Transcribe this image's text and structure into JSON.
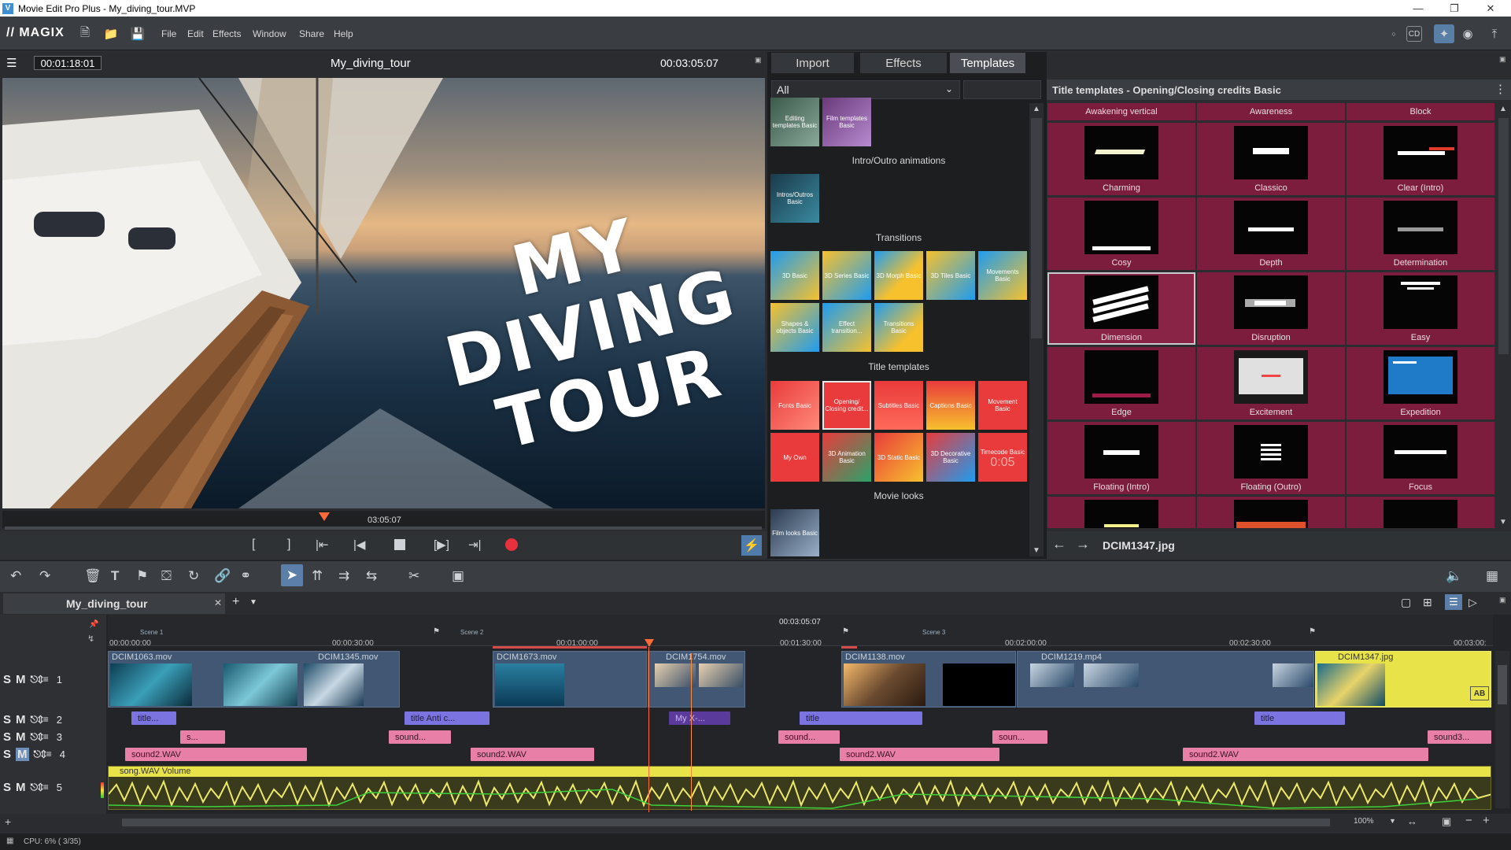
{
  "window": {
    "title": "Movie Edit Pro Plus - My_diving_tour.MVP",
    "app_icon": "V"
  },
  "menubar": {
    "logo": "// MAGIX",
    "items": [
      "File",
      "Edit",
      "Effects",
      "Window",
      "Share",
      "Help"
    ]
  },
  "preview": {
    "current_time": "00:01:18:01",
    "project_name": "My_diving_tour",
    "total_time": "00:03:05:07",
    "overlay_line1": "MY",
    "overlay_line2": "DIVING",
    "overlay_line3": "TOUR",
    "scrub_time": "03:05:07"
  },
  "media_panel": {
    "tabs": [
      "Import",
      "Effects",
      "Templates"
    ],
    "active_tab": "Templates",
    "filter_value": "All",
    "categories": {
      "top": [
        "Editing templates Basic",
        "Film templates Basic"
      ],
      "intro_label": "Intro/Outro animations",
      "intro": [
        "Intros/Outros Basic"
      ],
      "transitions_label": "Transitions",
      "transitions": [
        "3D Basic",
        "3D Series Basic",
        "3D Morph Basic",
        "3D Tiles Basic",
        "Movements Basic",
        "Shapes & objects Basic",
        "Effect transition...",
        "Transitions Basic"
      ],
      "title_label": "Title templates",
      "titles": [
        "Fonts Basic",
        "Opening/ Closing credit...",
        "Subtitles Basic",
        "Captions Basic",
        "Movement Basic",
        "My Own",
        "3D Animation Basic",
        "3D Static Basic",
        "3D Decorative Basic",
        "Timecode Basic"
      ],
      "looks_label": "Movie looks",
      "looks": [
        "Film looks Basic"
      ]
    },
    "timecode_thumb": "0:05"
  },
  "templates_panel": {
    "header": "Title templates - Opening/Closing credits Basic",
    "top_row": [
      "Awakening vertical",
      "Awareness",
      "Block"
    ],
    "items": [
      "Charming",
      "Classico",
      "Clear (Intro)",
      "Cosy",
      "Depth",
      "Determination",
      "Dimension",
      "Disruption",
      "Easy",
      "Edge",
      "Excitement",
      "Expedition",
      "Floating (Intro)",
      "Floating (Outro)",
      "Focus"
    ],
    "selected": "Dimension",
    "footer_file": "DCIM1347.jpg"
  },
  "timeline": {
    "tab_name": "My_diving_tour",
    "position": "00:03:05:07",
    "ruler": [
      "00:00:00:00",
      "00:00:30:00",
      "00:01:00:00",
      "00:01:30:00",
      "00:02:00:00",
      "00:02:30:00",
      "00:03:00:"
    ],
    "scenes": [
      "Scene 1",
      "Scene 2",
      "Scene 3"
    ],
    "clips": [
      "DCIM1063.mov",
      "DCIM1345.mov",
      "DCIM1673.mov",
      "DCIM1754.mov",
      "DCIM1138.mov",
      "DCIM1219.mp4",
      "DCIM1347.jpg"
    ],
    "ab_badge": "AB",
    "titles": [
      "title...",
      "title   Anti c...",
      "My   X-...",
      "title",
      "title"
    ],
    "sounds_t3": [
      "s...",
      "sound...",
      "sound...",
      "soun...",
      "sound3..."
    ],
    "sounds_t4": [
      "sound2.WAV",
      "sound2.WAV",
      "sound2.WAV",
      "sound2.WAV"
    ],
    "song": "song.WAV  Volume",
    "track_labels": [
      "S",
      "M"
    ],
    "track_numbers": [
      "1",
      "2",
      "3",
      "4",
      "5"
    ],
    "zoom": "100%"
  },
  "status": {
    "cpu": "CPU: 6% ( 3/35)"
  }
}
